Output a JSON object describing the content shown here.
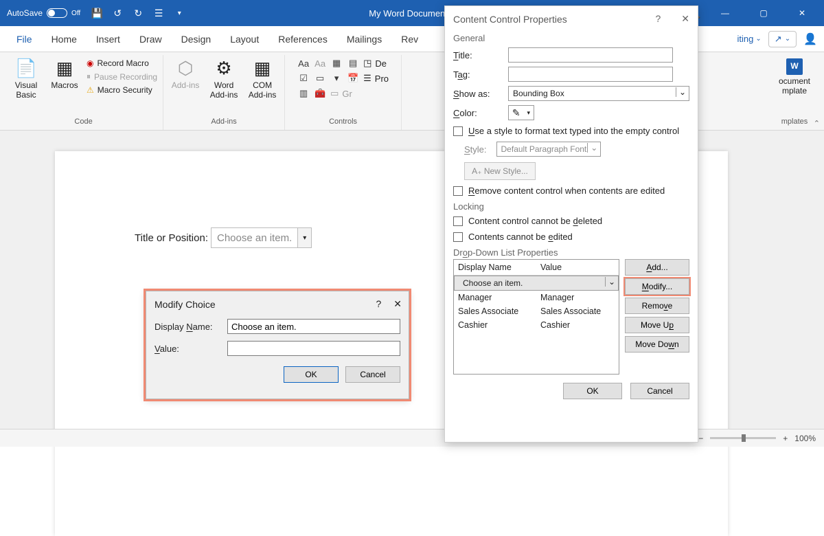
{
  "titlebar": {
    "autosave_label": "AutoSave",
    "autosave_state": "Off",
    "doc_title": "My Word Document..."
  },
  "tabs": [
    "File",
    "Home",
    "Insert",
    "Draw",
    "Design",
    "Layout",
    "References",
    "Mailings",
    "Rev"
  ],
  "editing_label": "iting",
  "ribbon": {
    "code": {
      "visual_basic": "Visual Basic",
      "macros": "Macros",
      "record_macro": "Record Macro",
      "pause_recording": "Pause Recording",
      "macro_security": "Macro Security",
      "group": "Code"
    },
    "addins": {
      "addins": "Add-ins",
      "word_addins": "Word Add-ins",
      "com_addins": "COM Add-ins",
      "group": "Add-ins"
    },
    "controls": {
      "de": "De",
      "pr": "Pro",
      "gr": "Gr",
      "group": "Controls"
    },
    "templates": {
      "label1": "ocument",
      "label2": "mplate",
      "group": "mplates"
    }
  },
  "document": {
    "field_label": "Title or Position:",
    "field_value": "Choose an item."
  },
  "modify_choice": {
    "title": "Modify Choice",
    "display_name_lbl": "Display Name:",
    "display_name_val": "Choose an item.",
    "value_lbl": "Value:",
    "value_val": "",
    "ok": "OK",
    "cancel": "Cancel"
  },
  "ccprops": {
    "title": "Content Control Properties",
    "general": "General",
    "title_lbl": "Title:",
    "title_val": "",
    "tag_lbl": "Tag:",
    "tag_val": "",
    "show_as_lbl": "Show as:",
    "show_as_val": "Bounding Box",
    "color_lbl": "Color:",
    "use_style": "Use a style to format text typed into the empty control",
    "style_lbl": "Style:",
    "style_val": "Default Paragraph Font",
    "new_style": "A₊ New Style...",
    "remove_cc": "Remove content control when contents are edited",
    "locking": "Locking",
    "cannot_delete": "Content control cannot be deleted",
    "cannot_edit": "Contents cannot be edited",
    "ddlp": "Drop-Down List Properties",
    "cols": {
      "display": "Display Name",
      "value": "Value"
    },
    "rows": [
      {
        "display": "Choose an item.",
        "value": ""
      },
      {
        "display": "Manager",
        "value": "Manager"
      },
      {
        "display": "Sales Associate",
        "value": "Sales Associate"
      },
      {
        "display": "Cashier",
        "value": "Cashier"
      }
    ],
    "add": "Add...",
    "modify": "Modify...",
    "remove": "Remove",
    "moveup": "Move Up",
    "movedown": "Move Down",
    "ok": "OK",
    "cancel": "Cancel"
  },
  "status": {
    "zoom": "100%"
  }
}
